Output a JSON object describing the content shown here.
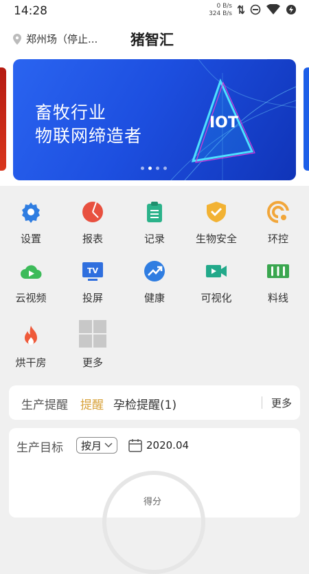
{
  "status": {
    "time": "14:28",
    "net_up": "0 B/s",
    "net_down": "324 B/s"
  },
  "header": {
    "location": "郑州场（停止...",
    "title": "猪智汇"
  },
  "banner": {
    "line1": "畜牧行业",
    "line2": "物联网缔造者",
    "badge": "IOT",
    "active_page": 2,
    "total_pages": 4
  },
  "grid": {
    "items": [
      {
        "label": "设置",
        "icon": "gear-icon",
        "color": "#2f7de1"
      },
      {
        "label": "报表",
        "icon": "pie-chart-icon",
        "color": "#e8503f"
      },
      {
        "label": "记录",
        "icon": "clipboard-icon",
        "color": "#2bb28a"
      },
      {
        "label": "生物安全",
        "icon": "shield-check-icon",
        "color": "#f2b233"
      },
      {
        "label": "环控",
        "icon": "ring-control-icon",
        "color": "#f1a63a"
      },
      {
        "label": "云视频",
        "icon": "cloud-play-icon",
        "color": "#3dbb5a"
      },
      {
        "label": "投屏",
        "icon": "tv-icon",
        "color": "#2f6fde"
      },
      {
        "label": "健康",
        "icon": "trend-up-icon",
        "color": "#2f7de1"
      },
      {
        "label": "可视化",
        "icon": "video-camera-icon",
        "color": "#22a98a"
      },
      {
        "label": "料线",
        "icon": "feed-line-icon",
        "color": "#3aa64f"
      },
      {
        "label": "烘干房",
        "icon": "flame-icon",
        "color": "#ef5a3a"
      },
      {
        "label": "更多",
        "icon": "more-grid-icon",
        "color": "#c8c8c8"
      }
    ]
  },
  "reminder": {
    "title": "生产提醒",
    "tag": "提醒",
    "item": "孕检提醒(1)",
    "more": "更多"
  },
  "goal": {
    "title": "生产目标",
    "period": "按月",
    "date": "2020.04",
    "gauge_label": "得分"
  }
}
